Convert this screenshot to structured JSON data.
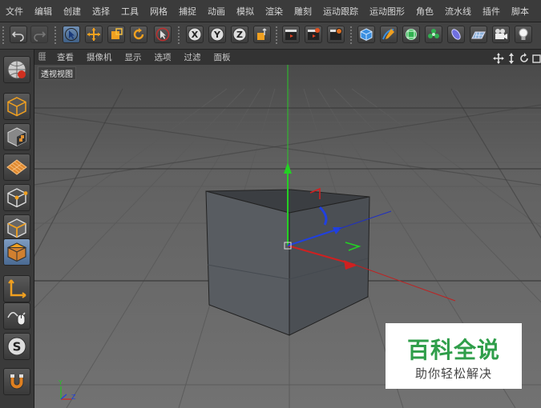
{
  "menubar": {
    "items": [
      "文件",
      "编辑",
      "创建",
      "选择",
      "工具",
      "网格",
      "捕捉",
      "动画",
      "模拟",
      "渲染",
      "雕刻",
      "运动跟踪",
      "运动图形",
      "角色",
      "流水线",
      "插件",
      "脚本"
    ]
  },
  "viewport_menu": {
    "items": [
      "查看",
      "摄像机",
      "显示",
      "选项",
      "过滤",
      "面板"
    ]
  },
  "viewport": {
    "label": "透视视图"
  },
  "watermark": {
    "title": "百科全说",
    "subtitle": "助你轻松解决"
  },
  "axis_indicator": {
    "x": "X",
    "y": "Y",
    "z": "Z"
  },
  "colors": {
    "accent_active": "#4a6a92",
    "x_axis": "#d02020",
    "y_axis": "#20c020",
    "z_axis": "#2040e0",
    "watermark_green": "#2f9e4a"
  },
  "toolbar": {
    "coord_x": "X",
    "coord_y": "Y",
    "coord_z": "Z"
  }
}
